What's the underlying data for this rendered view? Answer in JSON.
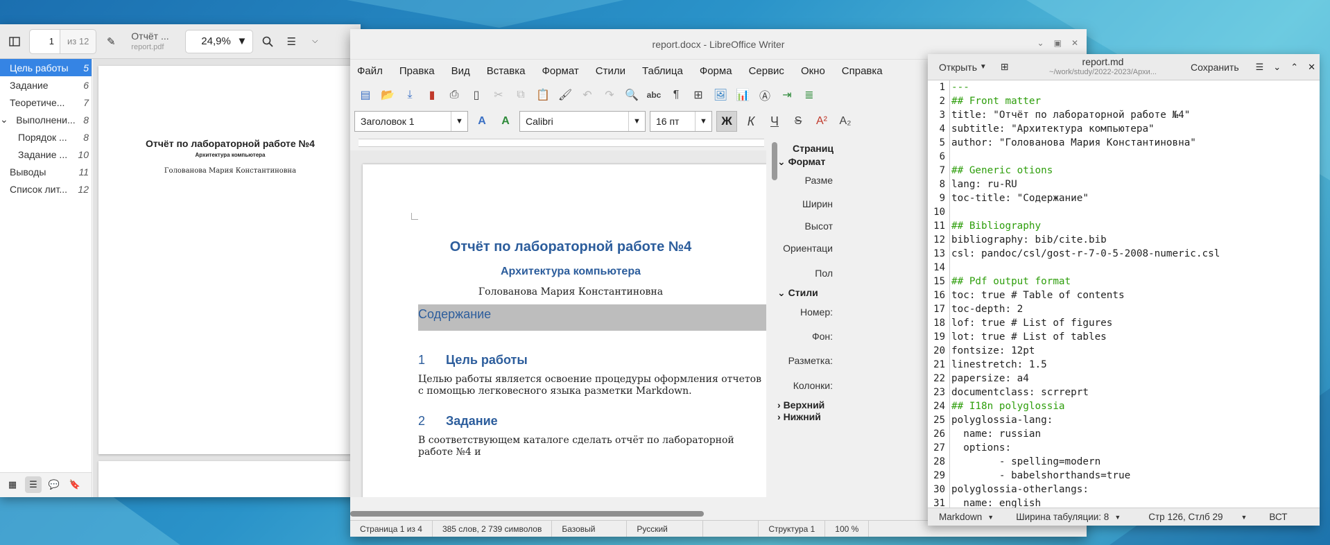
{
  "pdf_viewer": {
    "page_number": "1",
    "page_count": "из 12",
    "title": "Отчёт ...",
    "filename": "report.pdf",
    "zoom": "24,9%",
    "outline": [
      {
        "label": "Цель работы",
        "page": "5",
        "indent": 0,
        "active": true
      },
      {
        "label": "Задание",
        "page": "6",
        "indent": 0
      },
      {
        "label": "Теоретиче...",
        "page": "7",
        "indent": 0
      },
      {
        "label": "Выполнени...",
        "page": "8",
        "indent": 0,
        "expanded": true
      },
      {
        "label": "Порядок ...",
        "page": "8",
        "indent": 1
      },
      {
        "label": "Задание ...",
        "page": "10",
        "indent": 1
      },
      {
        "label": "Выводы",
        "page": "11",
        "indent": 0
      },
      {
        "label": "Список лит...",
        "page": "12",
        "indent": 0
      }
    ],
    "page_preview": {
      "title": "Отчёт по лабораторной работе №4",
      "subtitle": "Архитектура компьютера",
      "author": "Голованова Мария Константиновна"
    }
  },
  "writer": {
    "window_title": "report.docx - LibreOffice Writer",
    "menu": [
      "Файл",
      "Правка",
      "Вид",
      "Вставка",
      "Формат",
      "Стили",
      "Таблица",
      "Форма",
      "Сервис",
      "Окно",
      "Справка"
    ],
    "paragraph_style": "Заголовок 1",
    "font_name": "Calibri",
    "font_size": "16 пт",
    "bold_label": "Ж",
    "italic_label": "К",
    "underline_label": "Ч",
    "document": {
      "title": "Отчёт по лабораторной работе №4",
      "subtitle": "Архитектура компьютера",
      "author": "Голованова Мария Константиновна",
      "toc_heading": "Содержание",
      "h1_num": "1",
      "h1_text": "Цель работы",
      "p1": "Целью работы является освоение процедуры оформления отчетов с помощью легковесного языка разметки Markdown.",
      "h2_num": "2",
      "h2_text": "Задание",
      "p2": "В соответствующем каталоге сделать отчёт по лабораторной работе №4 и"
    },
    "sidebar": {
      "page_tab": "Страниц",
      "format_section": "Формат",
      "size": "Разме",
      "width": "Ширин",
      "height": "Высот",
      "orientation": "Ориентаци",
      "margins": "Пол",
      "styles_section": "Стили",
      "number": "Номер:",
      "background": "Фон:",
      "layout": "Разметка:",
      "columns": "Колонки:",
      "header": "Верхний",
      "footer": "Нижний"
    },
    "status": {
      "page": "Страница 1 из 4",
      "words": "385 слов, 2 739 символов",
      "style": "Базовый",
      "language": "Русский",
      "outline": "Структура 1",
      "zoom": "100 %"
    }
  },
  "editor": {
    "open_label": "Открыть",
    "filename": "report.md",
    "path": "~/work/study/2022-2023/Архи...",
    "save_label": "Сохранить",
    "lines": [
      "---",
      "## Front matter",
      "title: \"Отчёт по лабораторной работе №4\"",
      "subtitle: \"Архитектура компьютера\"",
      "author: \"Голованова Мария Константиновна\"",
      "",
      "## Generic otions",
      "lang: ru-RU",
      "toc-title: \"Содержание\"",
      "",
      "## Bibliography",
      "bibliography: bib/cite.bib",
      "csl: pandoc/csl/gost-r-7-0-5-2008-numeric.csl",
      "",
      "## Pdf output format",
      "toc: true # Table of contents",
      "toc-depth: 2",
      "lof: true # List of figures",
      "lot: true # List of tables",
      "fontsize: 12pt",
      "linestretch: 1.5",
      "papersize: a4",
      "documentclass: scrreprt",
      "## I18n polyglossia",
      "polyglossia-lang:",
      "  name: russian",
      "  options:",
      "        - spelling=modern",
      "        - babelshorthands=true",
      "polyglossia-otherlangs:",
      "  name: english"
    ],
    "status": {
      "language": "Markdown",
      "tab_width": "Ширина табуляции: 8",
      "position": "Стр 126, Стлб 29",
      "mode": "ВСТ"
    }
  }
}
